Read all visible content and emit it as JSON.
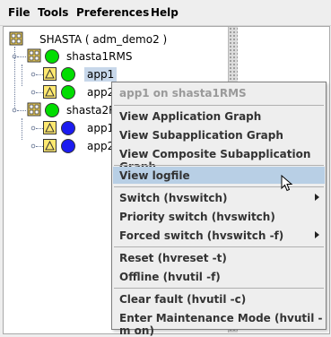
{
  "menubar": {
    "items": [
      "File",
      "Tools",
      "Preferences",
      "Help"
    ]
  },
  "tree": {
    "root_label": "SHASTA ( adm_demo2 )",
    "clusters": [
      {
        "label": "shasta1RMS",
        "status_color": "#00dd00",
        "apps": [
          {
            "label": "app1",
            "status_color": "#00dd00"
          },
          {
            "label": "app2",
            "status_color": "#00dd00"
          }
        ]
      },
      {
        "label": "shasta2RMS",
        "status_color": "#00dd00",
        "apps": [
          {
            "label": "app1",
            "status_color": "#1c1cf0"
          },
          {
            "label": "app2",
            "status_color": "#1c1cf0"
          }
        ]
      }
    ]
  },
  "context_menu": {
    "header": "app1 on shasta1RMS",
    "items": [
      {
        "label": "View Application Graph"
      },
      {
        "label": "View Subapplication Graph"
      },
      {
        "label": "View Composite Subapplication Graph"
      },
      {
        "label": "View logfile"
      },
      {
        "label": "Switch (hvswitch)"
      },
      {
        "label": "Priority switch (hvswitch)"
      },
      {
        "label": "Forced switch (hvswitch -f)"
      },
      {
        "label": "Reset (hvreset -t)"
      },
      {
        "label": "Offline (hvutil -f)"
      },
      {
        "label": "Clear fault (hvutil -c)"
      },
      {
        "label": "Enter Maintenance Mode (hvutil -m on)"
      }
    ]
  }
}
